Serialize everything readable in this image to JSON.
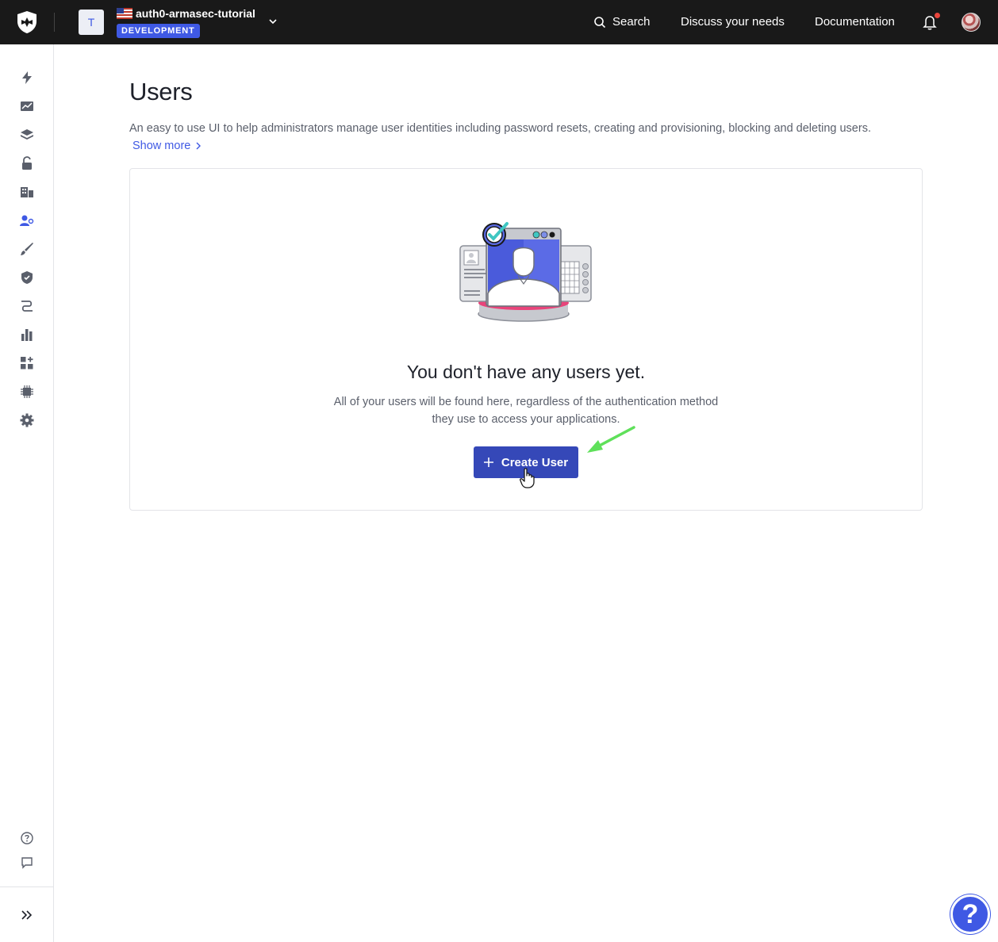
{
  "topbar": {
    "tenant_initial": "T",
    "tenant_name": "auth0-armasec-tutorial",
    "environment_badge": "DEVELOPMENT",
    "search_label": "Search",
    "discuss_label": "Discuss your needs",
    "docs_label": "Documentation",
    "notification_dot_color": "#e8453c"
  },
  "sidebar": {
    "items": [
      {
        "icon": "lightning-icon"
      },
      {
        "icon": "activity-chart-icon"
      },
      {
        "icon": "layers-icon"
      },
      {
        "icon": "lock-icon"
      },
      {
        "icon": "organizations-icon"
      },
      {
        "icon": "users-icon",
        "active": true
      },
      {
        "icon": "brush-icon"
      },
      {
        "icon": "shield-check-icon"
      },
      {
        "icon": "flows-icon"
      },
      {
        "icon": "bar-chart-icon"
      },
      {
        "icon": "extensions-icon"
      },
      {
        "icon": "chip-icon"
      },
      {
        "icon": "gear-icon"
      }
    ],
    "bottom": [
      {
        "icon": "help-circle-icon"
      },
      {
        "icon": "chat-icon"
      },
      {
        "icon": "expand-icon"
      }
    ]
  },
  "main": {
    "title": "Users",
    "description": "An easy to use UI to help administrators manage user identities including password resets, creating and provisioning, blocking and deleting users.",
    "show_more": "Show more",
    "empty_state": {
      "title": "You don't have any users yet.",
      "description": "All of your users will be found here, regardless of the authentication method they use to access your applications.",
      "button_label": "Create User"
    }
  },
  "help_fab": "?",
  "colors": {
    "accent": "#3f59e4",
    "button": "#3548b8",
    "topbar": "#191919",
    "annotation_arrow": "#5fe05a"
  }
}
